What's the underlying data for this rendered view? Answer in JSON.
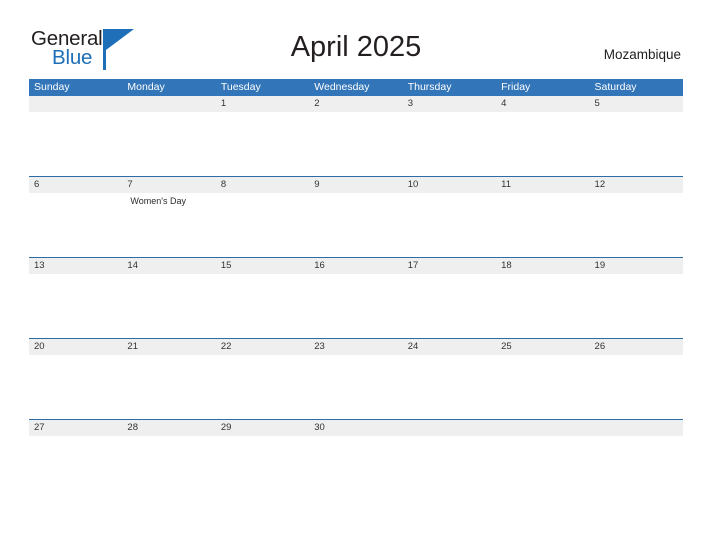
{
  "logo": {
    "word_one": "General",
    "word_two": "Blue",
    "flag_icon": "blue-flag-triangle-icon"
  },
  "header": {
    "title": "April 2025",
    "country": "Mozambique"
  },
  "colors": {
    "header_blue": "#3275b8",
    "row_divider_blue": "#2e6ca4",
    "date_band_gray": "#efefef",
    "logo_blue": "#1e6fb8",
    "text_dark": "#231f20"
  },
  "calendar": {
    "month": "April",
    "year": "2025",
    "weekdays": [
      "Sunday",
      "Monday",
      "Tuesday",
      "Wednesday",
      "Thursday",
      "Friday",
      "Saturday"
    ],
    "weeks": [
      {
        "days": [
          {
            "date": "",
            "events": []
          },
          {
            "date": "",
            "events": []
          },
          {
            "date": "1",
            "events": []
          },
          {
            "date": "2",
            "events": []
          },
          {
            "date": "3",
            "events": []
          },
          {
            "date": "4",
            "events": []
          },
          {
            "date": "5",
            "events": []
          }
        ]
      },
      {
        "days": [
          {
            "date": "6",
            "events": []
          },
          {
            "date": "7",
            "events": [
              "Women's Day"
            ]
          },
          {
            "date": "8",
            "events": []
          },
          {
            "date": "9",
            "events": []
          },
          {
            "date": "10",
            "events": []
          },
          {
            "date": "11",
            "events": []
          },
          {
            "date": "12",
            "events": []
          }
        ]
      },
      {
        "days": [
          {
            "date": "13",
            "events": []
          },
          {
            "date": "14",
            "events": []
          },
          {
            "date": "15",
            "events": []
          },
          {
            "date": "16",
            "events": []
          },
          {
            "date": "17",
            "events": []
          },
          {
            "date": "18",
            "events": []
          },
          {
            "date": "19",
            "events": []
          }
        ]
      },
      {
        "days": [
          {
            "date": "20",
            "events": []
          },
          {
            "date": "21",
            "events": []
          },
          {
            "date": "22",
            "events": []
          },
          {
            "date": "23",
            "events": []
          },
          {
            "date": "24",
            "events": []
          },
          {
            "date": "25",
            "events": []
          },
          {
            "date": "26",
            "events": []
          }
        ]
      },
      {
        "days": [
          {
            "date": "27",
            "events": []
          },
          {
            "date": "28",
            "events": []
          },
          {
            "date": "29",
            "events": []
          },
          {
            "date": "30",
            "events": []
          },
          {
            "date": "",
            "events": []
          },
          {
            "date": "",
            "events": []
          },
          {
            "date": "",
            "events": []
          }
        ]
      }
    ]
  }
}
